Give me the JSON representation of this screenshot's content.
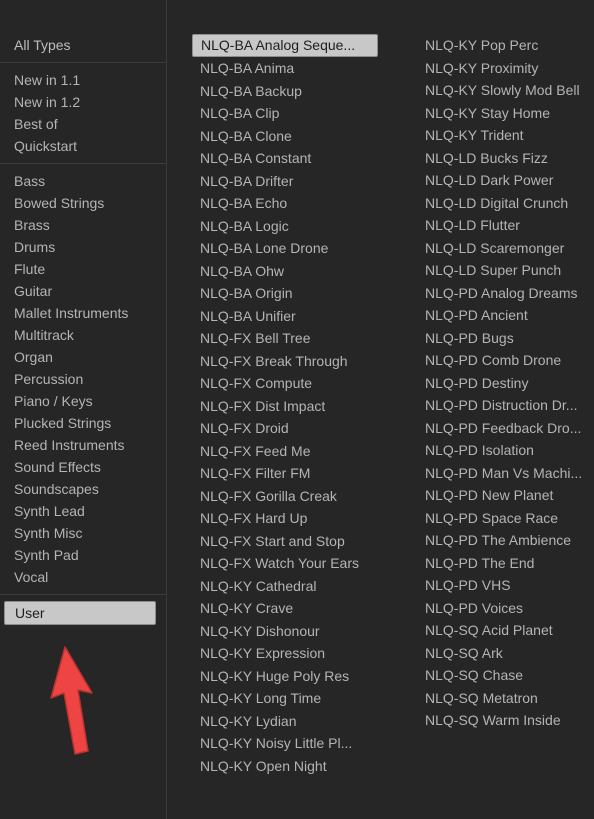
{
  "theme": {
    "background": "#262626",
    "text": "#b4b4b4",
    "selection_bg": "#c8c8c8",
    "selection_text": "#1e1e1e",
    "divider": "#3c3c3c",
    "annotation_arrow": "#ef4444"
  },
  "sidebar": {
    "header": {
      "label": "All Types"
    },
    "groups": [
      {
        "items": [
          {
            "label": "New in 1.1",
            "selected": false
          },
          {
            "label": "New in 1.2",
            "selected": false
          },
          {
            "label": "Best of",
            "selected": false
          },
          {
            "label": "Quickstart",
            "selected": false
          }
        ]
      },
      {
        "items": [
          {
            "label": "Bass",
            "selected": false
          },
          {
            "label": "Bowed Strings",
            "selected": false
          },
          {
            "label": "Brass",
            "selected": false
          },
          {
            "label": "Drums",
            "selected": false
          },
          {
            "label": "Flute",
            "selected": false
          },
          {
            "label": "Guitar",
            "selected": false
          },
          {
            "label": "Mallet Instruments",
            "selected": false
          },
          {
            "label": "Multitrack",
            "selected": false
          },
          {
            "label": "Organ",
            "selected": false
          },
          {
            "label": "Percussion",
            "selected": false
          },
          {
            "label": "Piano / Keys",
            "selected": false
          },
          {
            "label": "Plucked Strings",
            "selected": false
          },
          {
            "label": "Reed Instruments",
            "selected": false
          },
          {
            "label": "Sound Effects",
            "selected": false
          },
          {
            "label": "Soundscapes",
            "selected": false
          },
          {
            "label": "Synth Lead",
            "selected": false
          },
          {
            "label": "Synth Misc",
            "selected": false
          },
          {
            "label": "Synth Pad",
            "selected": false
          },
          {
            "label": "Vocal",
            "selected": false
          }
        ]
      },
      {
        "items": [
          {
            "label": "User",
            "selected": true
          }
        ]
      }
    ]
  },
  "results": {
    "columns": [
      {
        "items": [
          {
            "label": "NLQ-BA Analog Seque...",
            "selected": true
          },
          {
            "label": "NLQ-BA Anima",
            "selected": false
          },
          {
            "label": "NLQ-BA Backup",
            "selected": false
          },
          {
            "label": "NLQ-BA Clip",
            "selected": false
          },
          {
            "label": "NLQ-BA Clone",
            "selected": false
          },
          {
            "label": "NLQ-BA Constant",
            "selected": false
          },
          {
            "label": "NLQ-BA Drifter",
            "selected": false
          },
          {
            "label": "NLQ-BA Echo",
            "selected": false
          },
          {
            "label": "NLQ-BA Logic",
            "selected": false
          },
          {
            "label": "NLQ-BA Lone Drone",
            "selected": false
          },
          {
            "label": "NLQ-BA Ohw",
            "selected": false
          },
          {
            "label": "NLQ-BA Origin",
            "selected": false
          },
          {
            "label": "NLQ-BA Unifier",
            "selected": false
          },
          {
            "label": "NLQ-FX Bell Tree",
            "selected": false
          },
          {
            "label": "NLQ-FX Break Through",
            "selected": false
          },
          {
            "label": "NLQ-FX Compute",
            "selected": false
          },
          {
            "label": "NLQ-FX Dist Impact",
            "selected": false
          },
          {
            "label": "NLQ-FX Droid",
            "selected": false
          },
          {
            "label": "NLQ-FX Feed Me",
            "selected": false
          },
          {
            "label": "NLQ-FX Filter FM",
            "selected": false
          },
          {
            "label": "NLQ-FX Gorilla Creak",
            "selected": false
          },
          {
            "label": "NLQ-FX Hard Up",
            "selected": false
          },
          {
            "label": "NLQ-FX Start and Stop",
            "selected": false
          },
          {
            "label": "NLQ-FX Watch Your Ears",
            "selected": false
          },
          {
            "label": "NLQ-KY Cathedral",
            "selected": false
          },
          {
            "label": "NLQ-KY Crave",
            "selected": false
          },
          {
            "label": "NLQ-KY Dishonour",
            "selected": false
          },
          {
            "label": "NLQ-KY Expression",
            "selected": false
          },
          {
            "label": "NLQ-KY Huge Poly Res",
            "selected": false
          },
          {
            "label": "NLQ-KY Long Time",
            "selected": false
          },
          {
            "label": "NLQ-KY Lydian",
            "selected": false
          },
          {
            "label": "NLQ-KY Noisy Little Pl...",
            "selected": false
          },
          {
            "label": "NLQ-KY Open Night",
            "selected": false
          }
        ]
      },
      {
        "items": [
          {
            "label": "NLQ-KY Pop Perc",
            "selected": false
          },
          {
            "label": "NLQ-KY Proximity",
            "selected": false
          },
          {
            "label": "NLQ-KY Slowly Mod Bell",
            "selected": false
          },
          {
            "label": "NLQ-KY Stay Home",
            "selected": false
          },
          {
            "label": "NLQ-KY Trident",
            "selected": false
          },
          {
            "label": "NLQ-LD Bucks Fizz",
            "selected": false
          },
          {
            "label": "NLQ-LD Dark Power",
            "selected": false
          },
          {
            "label": "NLQ-LD Digital Crunch",
            "selected": false
          },
          {
            "label": "NLQ-LD Flutter",
            "selected": false
          },
          {
            "label": "NLQ-LD Scaremonger",
            "selected": false
          },
          {
            "label": "NLQ-LD Super Punch",
            "selected": false
          },
          {
            "label": "NLQ-PD Analog Dreams",
            "selected": false
          },
          {
            "label": "NLQ-PD Ancient",
            "selected": false
          },
          {
            "label": "NLQ-PD Bugs",
            "selected": false
          },
          {
            "label": "NLQ-PD Comb Drone",
            "selected": false
          },
          {
            "label": "NLQ-PD Destiny",
            "selected": false
          },
          {
            "label": "NLQ-PD Distruction Dr...",
            "selected": false
          },
          {
            "label": "NLQ-PD Feedback Dro...",
            "selected": false
          },
          {
            "label": "NLQ-PD Isolation",
            "selected": false
          },
          {
            "label": "NLQ-PD Man Vs Machi...",
            "selected": false
          },
          {
            "label": "NLQ-PD New Planet",
            "selected": false
          },
          {
            "label": "NLQ-PD Space Race",
            "selected": false
          },
          {
            "label": "NLQ-PD The Ambience",
            "selected": false
          },
          {
            "label": "NLQ-PD The End",
            "selected": false
          },
          {
            "label": "NLQ-PD VHS",
            "selected": false
          },
          {
            "label": "NLQ-PD Voices",
            "selected": false
          },
          {
            "label": "NLQ-SQ Acid Planet",
            "selected": false
          },
          {
            "label": "NLQ-SQ Ark",
            "selected": false
          },
          {
            "label": "NLQ-SQ Chase",
            "selected": false
          },
          {
            "label": "NLQ-SQ Metatron",
            "selected": false
          },
          {
            "label": "NLQ-SQ Warm Inside",
            "selected": false
          }
        ]
      }
    ]
  },
  "annotation": {
    "arrow": {
      "name": "red-up-arrow",
      "color": "#ef4444",
      "points_to": "User"
    }
  }
}
